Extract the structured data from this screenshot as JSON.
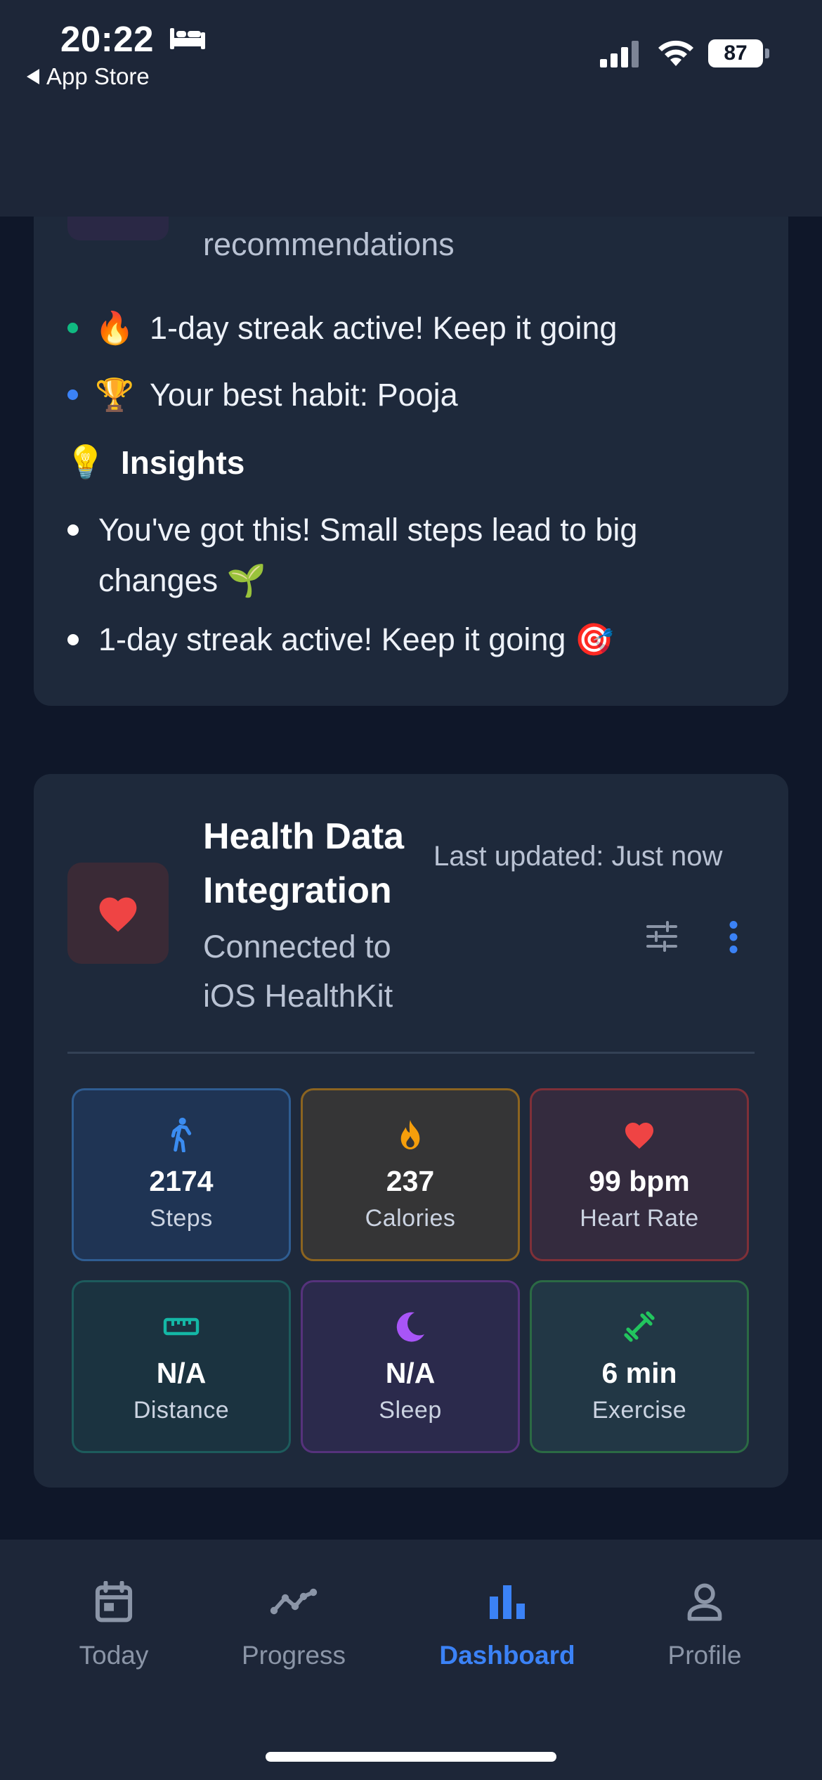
{
  "status_bar": {
    "time": "20:22",
    "back_label": "App Store",
    "battery": "87"
  },
  "recommendations": {
    "partial_text": "recommendations",
    "items": [
      {
        "emoji": "🔥",
        "text": "1-day streak active! Keep it going",
        "dot_color": "#10b981"
      },
      {
        "emoji": "🏆",
        "text": "Your best habit: Pooja",
        "dot_color": "#3b82f6"
      }
    ]
  },
  "insights": {
    "emoji": "💡",
    "title": "Insights",
    "items": [
      {
        "line1": "You've got this! Small steps lead to big",
        "line2": "changes 🌱"
      },
      {
        "line1": "1-day streak active! Keep it going 🎯"
      }
    ]
  },
  "health": {
    "title": "Health Data Integration",
    "subtitle": "Connected to iOS HealthKit",
    "last_updated": "Last updated: Just now",
    "metrics": [
      {
        "value": "2174",
        "label": "Steps",
        "icon": "walk-icon",
        "color": "#3b8cf0"
      },
      {
        "value": "237",
        "label": "Calories",
        "icon": "flame-icon",
        "color": "#f59e0b"
      },
      {
        "value": "99 bpm",
        "label": "Heart Rate",
        "icon": "heart-icon",
        "color": "#ef4444"
      },
      {
        "value": "N/A",
        "label": "Distance",
        "icon": "ruler-icon",
        "color": "#14b8a6"
      },
      {
        "value": "N/A",
        "label": "Sleep",
        "icon": "moon-icon",
        "color": "#a855f7"
      },
      {
        "value": "6 min",
        "label": "Exercise",
        "icon": "dumbbell-icon",
        "color": "#22c55e"
      }
    ]
  },
  "tabs": [
    {
      "label": "Today",
      "icon": "calendar-icon",
      "active": false
    },
    {
      "label": "Progress",
      "icon": "trend-icon",
      "active": false
    },
    {
      "label": "Dashboard",
      "icon": "bar-chart-icon",
      "active": true
    },
    {
      "label": "Profile",
      "icon": "person-icon",
      "active": false
    }
  ],
  "colors": {
    "accent": "#3b82f6",
    "background": "#0f1729",
    "card": "#1e293b",
    "header": "#1d2638"
  }
}
